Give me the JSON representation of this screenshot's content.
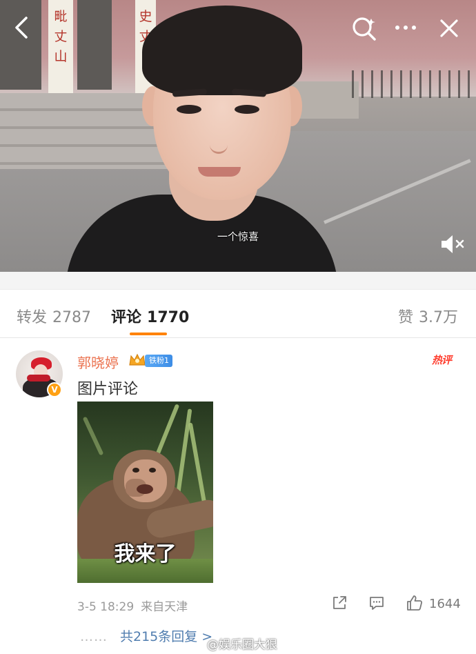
{
  "video": {
    "subtitle": "一个惊喜",
    "banner_left_text": "毗 丈 山",
    "banner_right_text": "史 丈"
  },
  "icons": {
    "back": "chevron-left-icon",
    "search": "search-icon",
    "more": "more-horizontal-icon",
    "close": "close-icon",
    "mute": "volume-muted-icon",
    "share": "share-icon",
    "reply": "comment-icon",
    "like": "thumbs-up-icon"
  },
  "tabs": [
    {
      "label": "转发",
      "count": "2787"
    },
    {
      "label": "评论",
      "count": "1770"
    },
    {
      "label": "赞",
      "count": "3.7万"
    }
  ],
  "accent_color": "#ff8200",
  "comment": {
    "username": "郭晓婷",
    "fan_badge": "铁粉1",
    "verified_mark": "V",
    "hot_badge": "热评",
    "text": "图片评论",
    "image_caption": "我来了",
    "time": "3-5 18:29",
    "location": "来自天津",
    "like_count": "1644",
    "replies_link": "共215条回复 >",
    "replies_dots": "……"
  },
  "watermark": "@娱乐圈大狠"
}
